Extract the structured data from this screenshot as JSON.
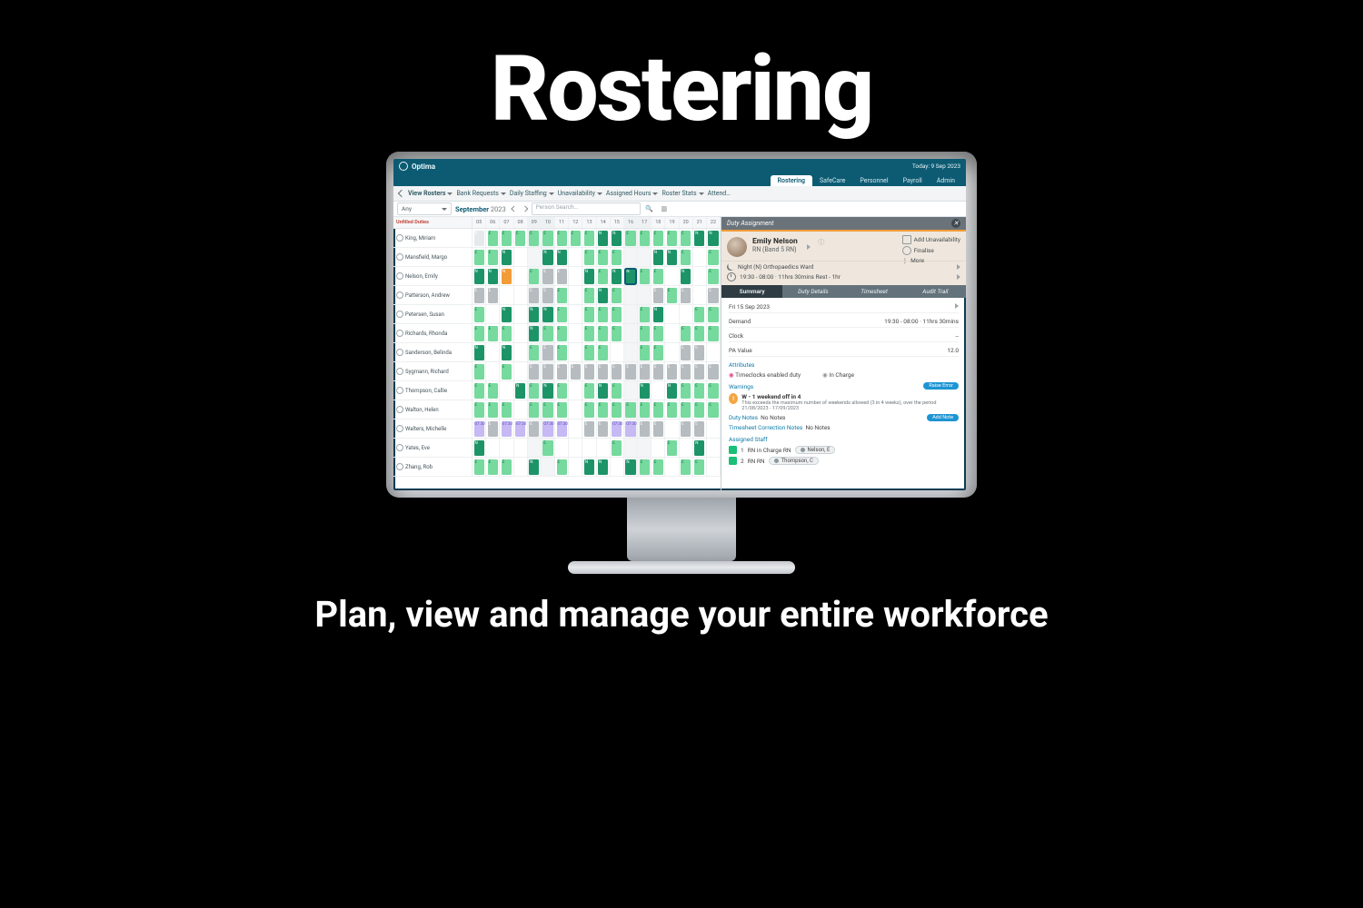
{
  "hero": {
    "title": "Rostering",
    "subtitle": "Plan, view and manage your entire workforce"
  },
  "app": {
    "brand": "Optima",
    "today": "Today: 9 Sep 2023",
    "tabs": [
      "Rostering",
      "SafeCare",
      "Personnel",
      "Payroll",
      "Admin"
    ],
    "active_tab": 0,
    "menus": [
      "View Rosters",
      "Bank Requests",
      "Daily Staffing",
      "Unavailability",
      "Assigned Hours",
      "Roster Stats",
      "Attend…"
    ],
    "filter": {
      "any": "Any",
      "month": "September",
      "year": "2023",
      "search_ph": "Person Search…"
    },
    "date_header_label": "Unfilled Duties",
    "days": [
      {
        "n": "05",
        "we": false
      },
      {
        "n": "06",
        "we": false
      },
      {
        "n": "07",
        "we": false
      },
      {
        "n": "08",
        "we": false
      },
      {
        "n": "09",
        "we": true
      },
      {
        "n": "10",
        "we": true
      },
      {
        "n": "11",
        "we": false
      },
      {
        "n": "12",
        "we": false
      },
      {
        "n": "13",
        "we": false
      },
      {
        "n": "14",
        "we": false
      },
      {
        "n": "15",
        "we": false
      },
      {
        "n": "16",
        "we": true
      },
      {
        "n": "17",
        "we": true
      },
      {
        "n": "18",
        "we": false
      },
      {
        "n": "19",
        "we": false
      },
      {
        "n": "20",
        "we": false
      },
      {
        "n": "21",
        "we": false
      },
      {
        "n": "22",
        "we": false
      }
    ],
    "staff": [
      {
        "name": "King, Miriam",
        "cells": "ellllllllddlllllddl"
      },
      {
        "name": "Mansfield, Margo",
        "cells": "lld..dd.lll..ddl.ll"
      },
      {
        "name": "Nelson, Emily",
        "cells": "ddo.lgg.dldSll.d.ll"
      },
      {
        "name": "Patterson, Andrew",
        "cells": "gg..ggl.ldl..glg.gg"
      },
      {
        "name": "Petersen, Susan",
        "cells": "l.d.ddl.lll.ld..lld"
      },
      {
        "name": "Richards, Rhonda",
        "cells": "lll.dll.lll.ll.llll"
      },
      {
        "name": "Sanderson, Belinda",
        "cells": "d.d.lgl.ll..ll.gg.l"
      },
      {
        "name": "Sygmann, Richard",
        "cells": "l.l.gggggggggggggg."
      },
      {
        "name": "Thompson, Callie",
        "cells": "ll.dldl.ldl.d.dlll."
      },
      {
        "name": "Walton, Helen",
        "cells": "lll.lll.lllllllllll"
      },
      {
        "name": "Walters, Michelle",
        "cells": "pgppgpp.ggppgg.gg.g"
      },
      {
        "name": "Yates, Eve",
        "cells": "d....l....l...l.d.."
      },
      {
        "name": "Zhang, Rob",
        "cells": "lll.d.l.dd.dll.ll.l"
      }
    ]
  },
  "panel": {
    "title": "Duty Assignment",
    "person": {
      "name": "Emily Nelson",
      "role": "RN (Band 5 RN)"
    },
    "actions": {
      "add_unavail": "Add Unavailability",
      "finalise": "Finalise",
      "more": "More"
    },
    "meta": {
      "shift": "Night (N) Orthopaedics Ward",
      "time": "19:30 - 08:00 · 11hrs 30mins  Rest - 1hr"
    },
    "ptabs": [
      "Summary",
      "Duty Details",
      "Timesheet",
      "Audit Trail"
    ],
    "ptab_active": 0,
    "summary": {
      "date": "Fri 15 Sep 2023",
      "rows": [
        {
          "k": "Demand",
          "v": "19:30 - 08:00 · 11hrs 30mins"
        },
        {
          "k": "Clock",
          "v": "--"
        },
        {
          "k": "PA Value",
          "v": "12.0"
        }
      ],
      "attr_label": "Attributes",
      "attr1": "Timeclocks enabled duty",
      "attr2": "In Charge",
      "warn_label": "Warnings",
      "warn_btn": "Raise Error",
      "warn_title": "W - 1 weekend off in 4",
      "warn_detail": "This exceeds the maximum number of weekends allowed (3 in 4 weeks), over the period 21/08/2023 - 17/09/2023",
      "notes_label": "Duty Notes",
      "notes_val": "No Notes",
      "notes_btn": "Add Note",
      "ts_label": "Timesheet Correction Notes",
      "ts_val": "No Notes",
      "assigned_label": "Assigned Staff",
      "assigned": [
        {
          "n": "1",
          "role": "RN in Charge RN",
          "person": "Nelson, E"
        },
        {
          "n": "2",
          "role": "RN RN",
          "person": "Thompson, C"
        }
      ]
    }
  }
}
